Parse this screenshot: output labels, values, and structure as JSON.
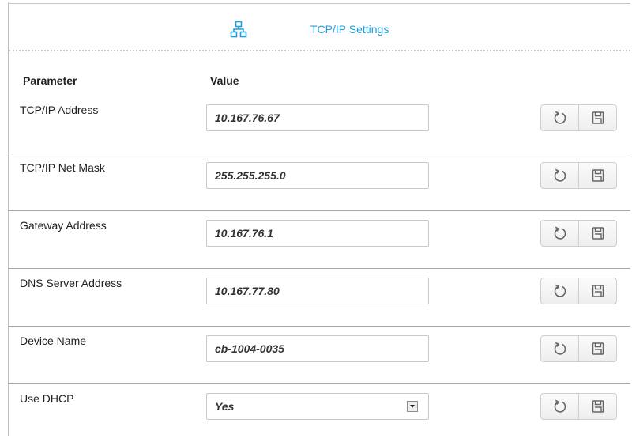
{
  "header": {
    "title": "TCP/IP Settings",
    "icon": "network-icon"
  },
  "table": {
    "col_parameter": "Parameter",
    "col_value": "Value",
    "rows": [
      {
        "label": "TCP/IP Address",
        "value": "10.167.76.67"
      },
      {
        "label": "TCP/IP Net Mask",
        "value": "255.255.255.0"
      },
      {
        "label": "Gateway Address",
        "value": "10.167.76.1"
      },
      {
        "label": "DNS Server Address",
        "value": "10.167.77.80"
      },
      {
        "label": "Device Name",
        "value": "cb-1004-0035"
      },
      {
        "label": "Use DHCP",
        "value": "Yes",
        "options": [
          "Yes"
        ]
      }
    ]
  },
  "actions": {
    "reset_icon": "refresh-icon",
    "save_icon": "save-icon"
  },
  "colors": {
    "accent": "#1f9fd8",
    "border": "#a9a9a9"
  }
}
